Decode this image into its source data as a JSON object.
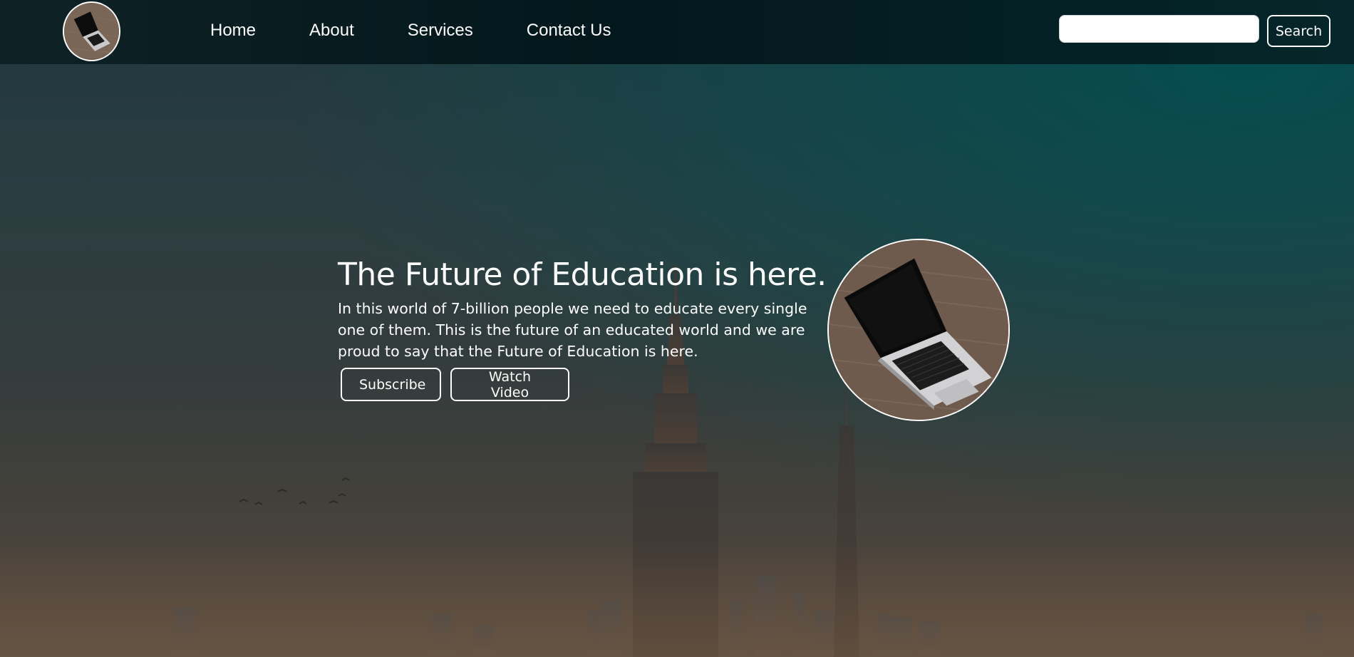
{
  "header": {
    "logo_icon": "laptop-logo-icon",
    "nav": [
      {
        "label": "Home"
      },
      {
        "label": "About"
      },
      {
        "label": "Services"
      },
      {
        "label": "Contact Us"
      }
    ],
    "search": {
      "value": "",
      "placeholder": "",
      "button_label": "Search"
    }
  },
  "hero": {
    "title": "The Future of Education is here.",
    "description": "In this world of 7-billion people we need to educate every single one of them. This is the future of an educated world and we are proud to say that the Future of Education is here.",
    "buttons": {
      "subscribe": "Subscribe",
      "watch_video": "Watch Video"
    },
    "image_icon": "laptop-on-desk-image"
  },
  "colors": {
    "navbar": "#03181c",
    "accent_teal": "#005052",
    "text": "#ffffff"
  }
}
